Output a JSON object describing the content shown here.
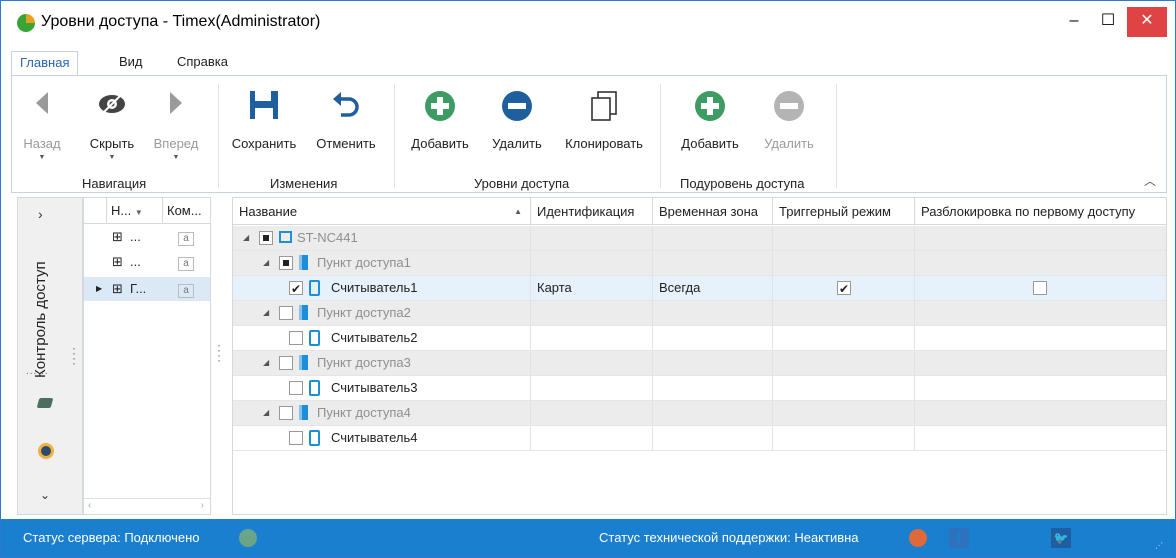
{
  "window": {
    "title": "Уровни доступа - Timex(Administrator)",
    "minimize": "–",
    "maximize": "☐",
    "close": "✕"
  },
  "tabs": [
    {
      "label": "Главная",
      "active": true
    },
    {
      "label": "Вид",
      "active": false
    },
    {
      "label": "Справка",
      "active": false
    }
  ],
  "ribbon": {
    "navigation": {
      "group_label": "Навигация",
      "back": "Назад",
      "hide": "Скрыть",
      "forward": "Вперед"
    },
    "changes": {
      "group_label": "Изменения",
      "save": "Сохранить",
      "cancel": "Отменить"
    },
    "access_levels": {
      "group_label": "Уровни доступа",
      "add": "Добавить",
      "delete": "Удалить",
      "clone": "Клонировать"
    },
    "sublevel": {
      "group_label": "Подуровень доступа",
      "add": "Добавить",
      "delete": "Удалить"
    },
    "collapse_icon": "chevron-up-icon"
  },
  "left_nav": {
    "vertical_label": "Контроль доступ",
    "expand_glyph": "›",
    "down_glyph": "⌄"
  },
  "small_panel": {
    "headers": [
      "Н...",
      "Ком..."
    ],
    "rows": [
      {
        "name": "...",
        "badge": "a"
      },
      {
        "name": "...",
        "badge": "a"
      },
      {
        "name": "Г...",
        "badge": "a",
        "selected": true
      }
    ]
  },
  "grid": {
    "headers": [
      "Название",
      "Идентификация",
      "Временная зона",
      "Триггерный режим",
      "Разблокировка по первому доступу"
    ],
    "rows": [
      {
        "level": 0,
        "kind": "device",
        "name": "ST-NC441",
        "check": "filled"
      },
      {
        "level": 1,
        "kind": "door",
        "name": "Пункт доступа1",
        "check": "filled"
      },
      {
        "level": 2,
        "kind": "reader",
        "name": "Считыватель1",
        "check": "checked",
        "identification": "Карта",
        "timezone": "Всегда",
        "trigger": true,
        "first_unlock": false
      },
      {
        "level": 1,
        "kind": "door",
        "name": "Пункт доступа2",
        "check": "none"
      },
      {
        "level": 2,
        "kind": "reader",
        "name": "Считыватель2",
        "check": "none"
      },
      {
        "level": 1,
        "kind": "door",
        "name": "Пункт доступа3",
        "check": "none"
      },
      {
        "level": 2,
        "kind": "reader",
        "name": "Считыватель3",
        "check": "none"
      },
      {
        "level": 1,
        "kind": "door",
        "name": "Пункт доступа4",
        "check": "none"
      },
      {
        "level": 2,
        "kind": "reader",
        "name": "Считыватель4",
        "check": "none"
      }
    ]
  },
  "status": {
    "server": "Статус сервера: Подключено",
    "server_color": "#6aa58a",
    "support": "Статус технической поддержки: Неактивна",
    "support_color": "#e0693a",
    "fb_icon": "facebook-icon",
    "tw_icon": "twitter-icon"
  }
}
